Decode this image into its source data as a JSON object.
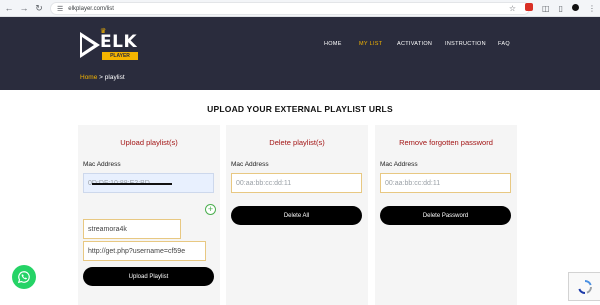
{
  "browser": {
    "url": "elkplayer.com/list"
  },
  "logo": {
    "brand": "ELK",
    "sub": "PLAYER"
  },
  "nav": {
    "items": [
      {
        "label": "HOME"
      },
      {
        "label": "MY LIST"
      },
      {
        "label": "ACTIVATION"
      },
      {
        "label": "INSTRUCTION"
      },
      {
        "label": "FAQ"
      }
    ],
    "active": "MY LIST"
  },
  "breadcrumb": {
    "home": "Home",
    "separator": ">",
    "current": "playlist"
  },
  "page": {
    "heading": "UPLOAD YOUR EXTERNAL PLAYLIST URLS"
  },
  "upload_card": {
    "title": "Upload playlist(s)",
    "mac_label": "Mac Address",
    "mac_value": "0D:DF:10:88:E2:BD",
    "playlist_name": "streamora4k",
    "playlist_url": "http://get.php?username=cf59e",
    "button": "Upload Playlist"
  },
  "delete_card": {
    "title": "Delete playlist(s)",
    "mac_label": "Mac Address",
    "mac_placeholder": "00:aa:bb:cc:dd:11",
    "button": "Delete All"
  },
  "password_card": {
    "title": "Remove forgotten password",
    "mac_label": "Mac Address",
    "mac_placeholder": "00:aa:bb:cc:dd:11",
    "button": "Delete Password"
  },
  "icons": {
    "back": "back-arrow-icon",
    "forward": "forward-arrow-icon",
    "reload": "reload-icon",
    "site_info": "tune-icon",
    "bookmark": "star-icon",
    "extension": "extension-icon",
    "puzzle": "puzzle-icon",
    "menu": "kebab-icon",
    "add": "plus-icon",
    "whatsapp": "whatsapp-icon",
    "recaptcha": "recaptcha-icon"
  },
  "colors": {
    "header_bg": "#2a2c3d",
    "accent": "#f4b400",
    "card_title": "#a31515",
    "button_bg": "#000000",
    "whatsapp": "#25d366"
  }
}
